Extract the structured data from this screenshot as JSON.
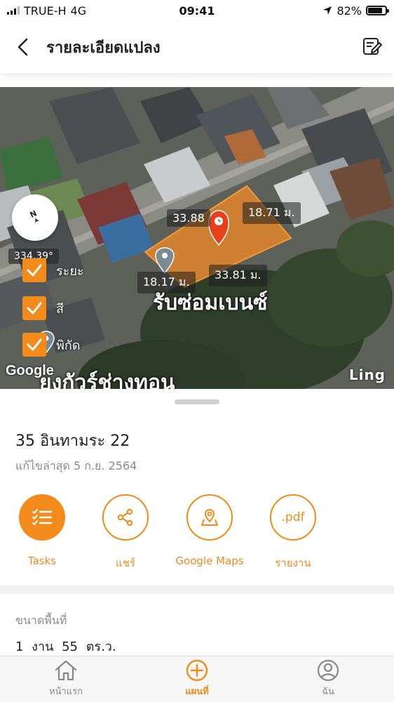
{
  "status_bar": {
    "carrier": "TRUE-H",
    "network": "4G",
    "time": "09:41",
    "battery_percent": "82%",
    "battery_level": 0.82
  },
  "header": {
    "title": "รายละเอียดแปลง",
    "back_icon": "chevron-left-icon",
    "edit_icon": "edit-note-icon"
  },
  "map": {
    "bearing": "334.39°",
    "measurements": {
      "top": "33.88",
      "right": "18.71 ม.",
      "bottom": "33.81 ม.",
      "left": "18.17 ม."
    },
    "place_labels": {
      "shop": "รับซ่อมเบนซ์",
      "street": "ยงกัวร์ช่างทอน"
    },
    "toggles": [
      {
        "label": "ระยะ",
        "checked": true
      },
      {
        "label": "สี",
        "checked": true
      },
      {
        "label": "พิกัด",
        "checked": true
      }
    ],
    "attribution": "Google",
    "corner_text": "Ling"
  },
  "plot": {
    "name": "35 อินทามระ 22",
    "last_edited": "แก้ไขล่าสุด 5 ก.ย. 2564"
  },
  "actions": [
    {
      "label": "Tasks",
      "icon": "checklist-icon"
    },
    {
      "label": "แชร์",
      "icon": "share-icon"
    },
    {
      "label": "Google Maps",
      "icon": "map-pin-icon"
    },
    {
      "label": "รายงาน",
      "icon": "pdf-icon",
      "icon_text": ".pdf"
    }
  ],
  "area": {
    "label": "ขนาดพื้นที่",
    "value": "1 งาน 55 ตร.ว."
  },
  "bottom_nav": [
    {
      "label": "หน้าแรก",
      "icon": "home-icon",
      "active": false
    },
    {
      "label": "แผนที่",
      "icon": "add-circle-icon",
      "active": true
    },
    {
      "label": "ฉัน",
      "icon": "user-icon",
      "active": false
    }
  ],
  "colors": {
    "accent": "#f28a1c",
    "plot_fill": "#f28a1c",
    "marker_red": "#e8401c",
    "marker_gray": "#7c8a92"
  }
}
